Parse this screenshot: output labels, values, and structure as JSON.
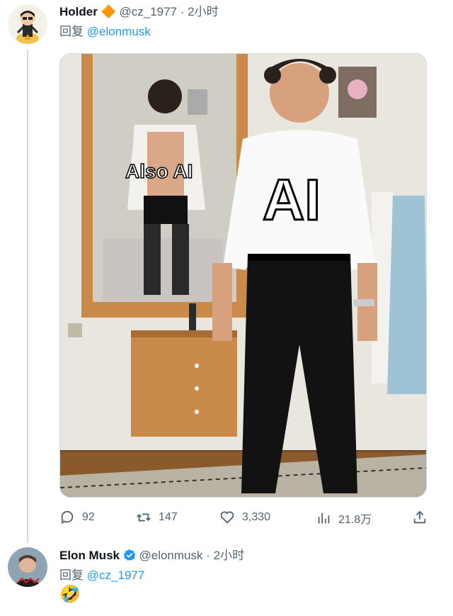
{
  "tweet1": {
    "display_name": "Holder",
    "badge": "🔶",
    "handle": "@cz_1977",
    "separator": "·",
    "time": "2小时",
    "reply_prefix": "回复",
    "reply_to": "@elonmusk",
    "image": {
      "caption_mirror": "Also AI",
      "caption_main": "AI"
    },
    "stats": {
      "replies": "92",
      "retweets": "147",
      "likes": "3,330",
      "views": "21.8万"
    }
  },
  "tweet2": {
    "display_name": "Elon Musk",
    "handle": "@elonmusk",
    "separator": "·",
    "time": "2小时",
    "reply_prefix": "回复",
    "reply_to": "@cz_1977",
    "body_emoji": "🤣"
  },
  "colors": {
    "link": "#1d9bf0",
    "muted": "#536471",
    "verified": "#1d9bf0",
    "divider": "#cfd9de"
  },
  "icons": {
    "reply": "reply-icon",
    "retweet": "retweet-icon",
    "like": "heart-icon",
    "views": "views-icon",
    "share": "share-icon",
    "verified": "verified-badge-icon"
  }
}
